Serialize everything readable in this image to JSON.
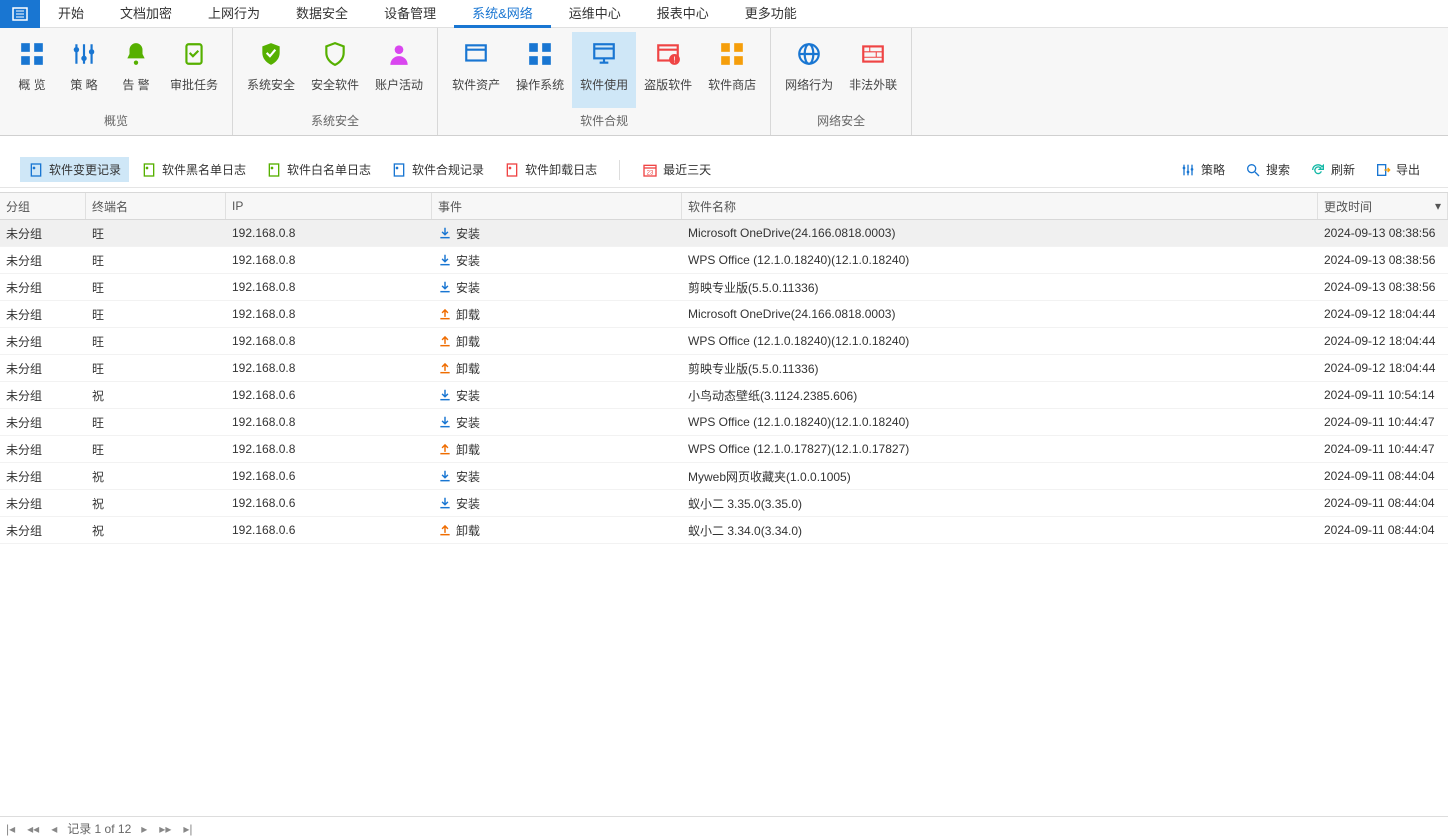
{
  "menu": {
    "items": [
      "开始",
      "文档加密",
      "上网行为",
      "数据安全",
      "设备管理",
      "系统&网络",
      "运维中心",
      "报表中心",
      "更多功能"
    ],
    "activeIndex": 5
  },
  "ribbon": {
    "groups": [
      {
        "label": "概览",
        "items": [
          {
            "name": "overview",
            "label": "概 览",
            "icon": "grid",
            "color": "#1976d2"
          },
          {
            "name": "policy",
            "label": "策 略",
            "icon": "sliders",
            "color": "#1976d2"
          },
          {
            "name": "alert",
            "label": "告 警",
            "icon": "bell",
            "color": "#56b000"
          },
          {
            "name": "approve",
            "label": "审批任务",
            "icon": "clipboard",
            "color": "#56b000"
          }
        ]
      },
      {
        "label": "系统安全",
        "items": [
          {
            "name": "syssec",
            "label": "系统安全",
            "icon": "shield-check",
            "color": "#56b000"
          },
          {
            "name": "secsoft",
            "label": "安全软件",
            "icon": "shield",
            "color": "#56b000"
          },
          {
            "name": "account",
            "label": "账户活动",
            "icon": "user",
            "color": "#d946ef"
          }
        ]
      },
      {
        "label": "软件合规",
        "items": [
          {
            "name": "swasset",
            "label": "软件资产",
            "icon": "window",
            "color": "#1976d2"
          },
          {
            "name": "os",
            "label": "操作系统",
            "icon": "grid4",
            "color": "#1976d2"
          },
          {
            "name": "swuse",
            "label": "软件使用",
            "icon": "monitor",
            "color": "#1976d2",
            "active": true
          },
          {
            "name": "pirate",
            "label": "盗版软件",
            "icon": "window-alert",
            "color": "#ef4444"
          },
          {
            "name": "swstore",
            "label": "软件商店",
            "icon": "grid4",
            "color": "#f59e0b"
          }
        ]
      },
      {
        "label": "网络安全",
        "items": [
          {
            "name": "netact",
            "label": "网络行为",
            "icon": "globe",
            "color": "#1976d2"
          },
          {
            "name": "illegal",
            "label": "非法外联",
            "icon": "wall",
            "color": "#ef4444"
          }
        ]
      }
    ]
  },
  "toolbar": {
    "left": [
      {
        "name": "change-log",
        "label": "软件变更记录",
        "active": true,
        "iconColor": "#1976d2"
      },
      {
        "name": "blacklist-log",
        "label": "软件黑名单日志",
        "iconColor": "#56b000"
      },
      {
        "name": "whitelist-log",
        "label": "软件白名单日志",
        "iconColor": "#56b000"
      },
      {
        "name": "compliance-log",
        "label": "软件合规记录",
        "iconColor": "#1976d2"
      },
      {
        "name": "uninstall-log",
        "label": "软件卸载日志",
        "iconColor": "#ef4444"
      }
    ],
    "recent": "最近三天",
    "right": [
      {
        "name": "policy",
        "label": "策略",
        "icon": "sliders"
      },
      {
        "name": "search",
        "label": "搜索",
        "icon": "search"
      },
      {
        "name": "refresh",
        "label": "刷新",
        "icon": "refresh"
      },
      {
        "name": "export",
        "label": "导出",
        "icon": "export"
      }
    ]
  },
  "grid": {
    "columns": {
      "group": "分组",
      "terminal": "终端名",
      "ip": "IP",
      "event": "事件",
      "software": "软件名称",
      "time": "更改时间"
    },
    "rows": [
      {
        "group": "未分组",
        "terminal": "旺",
        "ip": "192.168.0.8",
        "event": "安装",
        "etype": "install",
        "software": "Microsoft OneDrive(24.166.0818.0003)",
        "time": "2024-09-13 08:38:56"
      },
      {
        "group": "未分组",
        "terminal": "旺",
        "ip": "192.168.0.8",
        "event": "安装",
        "etype": "install",
        "software": "WPS Office (12.1.0.18240)(12.1.0.18240)",
        "time": "2024-09-13 08:38:56"
      },
      {
        "group": "未分组",
        "terminal": "旺",
        "ip": "192.168.0.8",
        "event": "安装",
        "etype": "install",
        "software": "剪映专业版(5.5.0.11336)",
        "time": "2024-09-13 08:38:56"
      },
      {
        "group": "未分组",
        "terminal": "旺",
        "ip": "192.168.0.8",
        "event": "卸载",
        "etype": "uninstall",
        "software": "Microsoft OneDrive(24.166.0818.0003)",
        "time": "2024-09-12 18:04:44"
      },
      {
        "group": "未分组",
        "terminal": "旺",
        "ip": "192.168.0.8",
        "event": "卸载",
        "etype": "uninstall",
        "software": "WPS Office (12.1.0.18240)(12.1.0.18240)",
        "time": "2024-09-12 18:04:44"
      },
      {
        "group": "未分组",
        "terminal": "旺",
        "ip": "192.168.0.8",
        "event": "卸载",
        "etype": "uninstall",
        "software": "剪映专业版(5.5.0.11336)",
        "time": "2024-09-12 18:04:44"
      },
      {
        "group": "未分组",
        "terminal": "祝",
        "ip": "192.168.0.6",
        "event": "安装",
        "etype": "install",
        "software": "小鸟动态壁纸(3.1124.2385.606)",
        "time": "2024-09-11 10:54:14"
      },
      {
        "group": "未分组",
        "terminal": "旺",
        "ip": "192.168.0.8",
        "event": "安装",
        "etype": "install",
        "software": "WPS Office (12.1.0.18240)(12.1.0.18240)",
        "time": "2024-09-11 10:44:47"
      },
      {
        "group": "未分组",
        "terminal": "旺",
        "ip": "192.168.0.8",
        "event": "卸载",
        "etype": "uninstall",
        "software": "WPS Office (12.1.0.17827)(12.1.0.17827)",
        "time": "2024-09-11 10:44:47"
      },
      {
        "group": "未分组",
        "terminal": "祝",
        "ip": "192.168.0.6",
        "event": "安装",
        "etype": "install",
        "software": "Myweb网页收藏夹(1.0.0.1005)",
        "time": "2024-09-11 08:44:04"
      },
      {
        "group": "未分组",
        "terminal": "祝",
        "ip": "192.168.0.6",
        "event": "安装",
        "etype": "install",
        "software": "蚁小二 3.35.0(3.35.0)",
        "time": "2024-09-11 08:44:04"
      },
      {
        "group": "未分组",
        "terminal": "祝",
        "ip": "192.168.0.6",
        "event": "卸载",
        "etype": "uninstall",
        "software": "蚁小二 3.34.0(3.34.0)",
        "time": "2024-09-11 08:44:04"
      }
    ]
  },
  "footer": {
    "text": "记录 1 of 12"
  }
}
